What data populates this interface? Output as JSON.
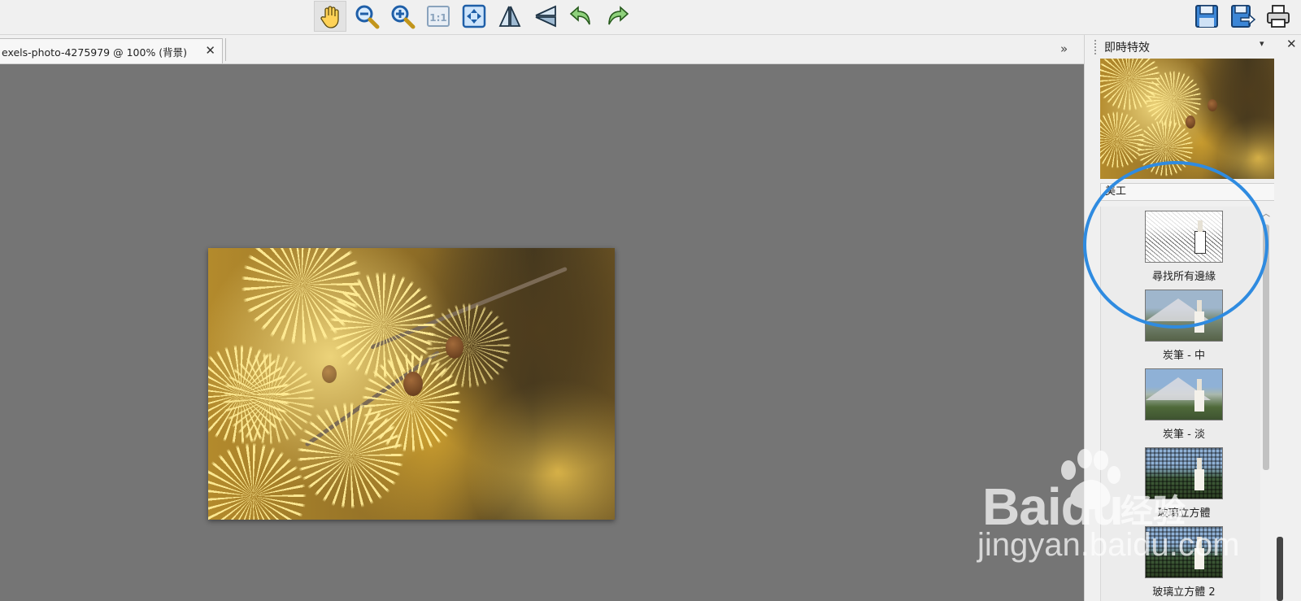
{
  "toolbar": {
    "buttons": [
      {
        "name": "hand-tool",
        "icon": "hand-icon",
        "active": true
      },
      {
        "name": "zoom-out",
        "icon": "zoom-out-icon"
      },
      {
        "name": "zoom-in",
        "icon": "zoom-in-icon"
      },
      {
        "name": "actual-size",
        "icon": "one-to-one-icon",
        "label": "1:1"
      },
      {
        "name": "fit-window",
        "icon": "fit-window-icon"
      },
      {
        "name": "flip-horizontal",
        "icon": "flip-horizontal-icon"
      },
      {
        "name": "flip-vertical",
        "icon": "flip-vertical-icon"
      },
      {
        "name": "rotate-left",
        "icon": "rotate-left-icon"
      },
      {
        "name": "rotate-right",
        "icon": "rotate-right-icon"
      },
      {
        "name": "save",
        "icon": "save-icon"
      },
      {
        "name": "save-as",
        "icon": "save-as-icon"
      },
      {
        "name": "print",
        "icon": "print-icon"
      }
    ]
  },
  "document_tab": {
    "label": "exels-photo-4275979 @ 100% (背景)",
    "close": "✕",
    "scroll_arrow": "»"
  },
  "panel": {
    "title": "即時特效",
    "menu_arrow": "▾",
    "pin": "⊥",
    "close": "✕",
    "category": "美工",
    "category_arrow": "▾",
    "effects": [
      {
        "label": "尋找所有邊緣",
        "style": "sketch"
      },
      {
        "label": "炭筆 - 中",
        "style": "charcoal-mid"
      },
      {
        "label": "炭筆 - 淡",
        "style": "charcoal-light"
      },
      {
        "label": "玻璃立方體",
        "style": "glass"
      },
      {
        "label": "玻璃立方體 2",
        "style": "glass"
      }
    ]
  },
  "annotation": {
    "color": "#2f8be0"
  },
  "watermark": {
    "logo": "Baidu",
    "brand": "经验",
    "url": "jingyan.baidu.com"
  },
  "colors": {
    "canvas": "#757575",
    "chrome": "#f0f0f0",
    "icon_blue": "#1f5fa8",
    "icon_green": "#3d9a3d"
  }
}
